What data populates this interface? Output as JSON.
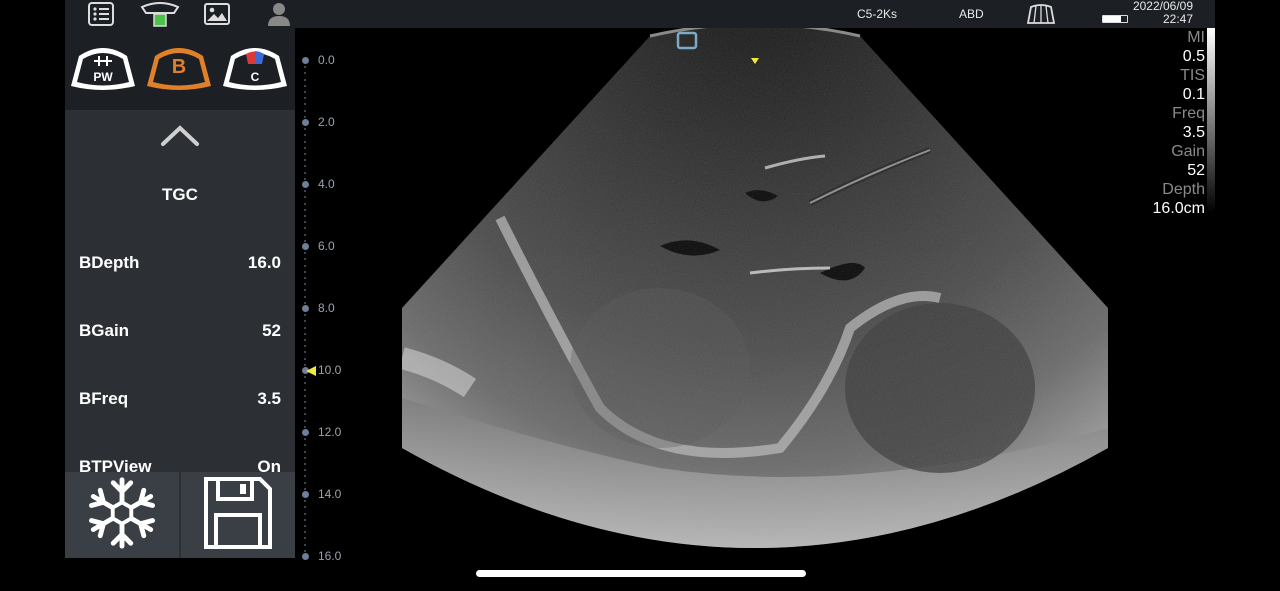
{
  "topbar": {
    "probe": "C5-2Ks",
    "preset": "ABD",
    "date": "2022/06/09",
    "time": "22:47",
    "battery_level": 0.75,
    "icons": [
      "list-icon",
      "probe-icon",
      "gallery-icon",
      "user-icon",
      "scan-area-icon"
    ]
  },
  "modes": {
    "pw": "PW",
    "b": "B",
    "c": "C",
    "active": "B",
    "accent": "#e0802a"
  },
  "panel": {
    "tgc": "TGC",
    "params": [
      {
        "label": "BDepth",
        "value": "16.0"
      },
      {
        "label": "BGain",
        "value": "52"
      },
      {
        "label": "BFreq",
        "value": "3.5"
      },
      {
        "label": "BTPView",
        "value": "On"
      }
    ]
  },
  "scale": {
    "labels": [
      "0.0",
      "2.0",
      "4.0",
      "6.0",
      "8.0",
      "10.0",
      "12.0",
      "14.0",
      "16.0"
    ]
  },
  "info": {
    "mi_label": "MI",
    "mi": "0.5",
    "tis_label": "TIS",
    "tis": "0.1",
    "freq_label": "Freq",
    "freq": "3.5",
    "gain_label": "Gain",
    "gain": "52",
    "depth_label": "Depth",
    "depth": "16.0cm"
  }
}
